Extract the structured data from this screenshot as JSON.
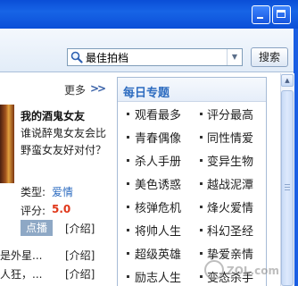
{
  "window": {
    "controls": [
      "minimize",
      "maximize"
    ]
  },
  "search": {
    "value": "最佳拍档",
    "button": "搜索",
    "icon": "search-icon",
    "dropdown_icon": "chevron-down-icon"
  },
  "left": {
    "more_label": "更多",
    "more_arrow": ">>",
    "movie": {
      "title": "我的酒鬼女友",
      "description": "谁说醉鬼女友会比野蛮女友好对付？",
      "type_label": "类型:",
      "type_value": "爱情",
      "score_label": "评分:",
      "score_value": "5.0",
      "play_label": "点播",
      "intro_label": "[介绍]"
    },
    "rows": [
      {
        "text": "是外星...",
        "intro": "[介绍]"
      },
      {
        "text": "人狂，...",
        "intro": "[介绍]"
      }
    ]
  },
  "panel": {
    "title": "每日专题",
    "topics": [
      [
        "观看最多",
        "评分最高"
      ],
      [
        "青春偶像",
        "同性情爱"
      ],
      [
        "杀人手册",
        "变异生物"
      ],
      [
        "美色诱惑",
        "越战泥潭"
      ],
      [
        "核弹危机",
        "烽火爱情"
      ],
      [
        "将帅人生",
        "科幻圣经"
      ],
      [
        "超级英雄",
        "挚爱亲情"
      ],
      [
        "励志人生",
        "变态杀手"
      ]
    ]
  },
  "watermark": "ZOL .com.cn",
  "colors": {
    "titlebar": "#1764e6",
    "panel_title": "#2d6cc0",
    "score": "#e0371a",
    "type_value": "#2d6cc0"
  }
}
